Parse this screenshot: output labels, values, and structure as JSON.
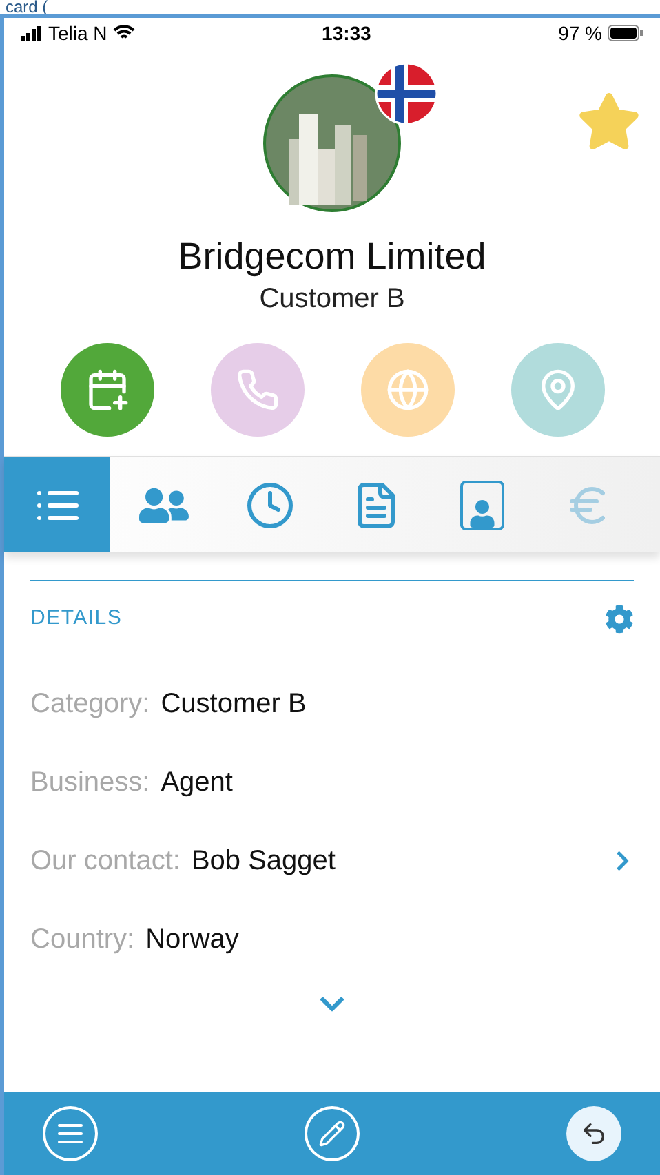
{
  "caption": "card (",
  "status_bar": {
    "carrier": "Telia N",
    "time": "13:33",
    "battery": "97 %"
  },
  "company": {
    "name": "Bridgecom Limited",
    "category": "Customer B",
    "favorite": true
  },
  "actions": [
    {
      "kind": "calendar",
      "color": "#52a83a"
    },
    {
      "kind": "phone",
      "color": "#e6cde8"
    },
    {
      "kind": "web",
      "color": "#fddba6"
    },
    {
      "kind": "location",
      "color": "#b1dcdc"
    }
  ],
  "tabs": [
    {
      "kind": "list",
      "selected": true,
      "disabled": false
    },
    {
      "kind": "contacts",
      "selected": false,
      "disabled": false
    },
    {
      "kind": "clock",
      "selected": false,
      "disabled": false
    },
    {
      "kind": "document",
      "selected": false,
      "disabled": false
    },
    {
      "kind": "badge",
      "selected": false,
      "disabled": false
    },
    {
      "kind": "currency",
      "selected": false,
      "disabled": true
    }
  ],
  "details": {
    "title": "DETAILS",
    "fields": [
      {
        "label": "Category:",
        "value": "Customer B",
        "link": false
      },
      {
        "label": "Business:",
        "value": "Agent",
        "link": false
      },
      {
        "label": "Our contact:",
        "value": "Bob Sagget",
        "link": true
      },
      {
        "label": "Country:",
        "value": "Norway",
        "link": false
      }
    ]
  }
}
